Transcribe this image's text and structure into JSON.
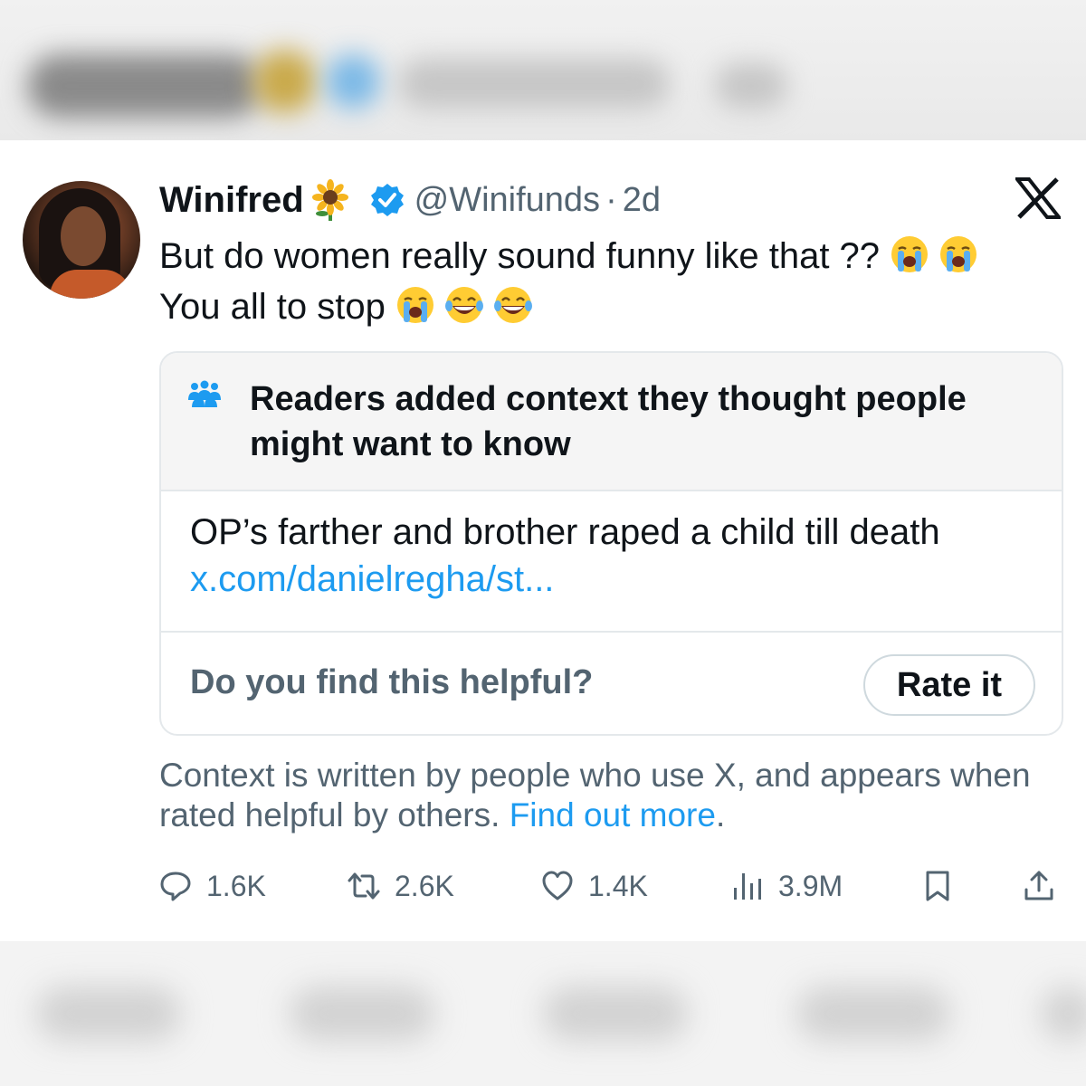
{
  "author": {
    "name": "Winifred",
    "handle": "@Winifunds",
    "separator": "·",
    "time": "2d",
    "verified": true
  },
  "tweet": {
    "line1": "But do women really sound funny like that ??",
    "line2": "You all to stop"
  },
  "note": {
    "title": "Readers added context they thought people might want to know",
    "body": "OP’s farther and brother raped a child till death",
    "link": "x.com/danielregha/st...",
    "question": "Do you find this helpful?",
    "rate_label": "Rate it"
  },
  "context": {
    "text": "Context is written by people who use X, and appears when rated helpful by others.",
    "link": "Find out more",
    "period": "."
  },
  "actions": {
    "replies": "1.6K",
    "reposts": "2.6K",
    "likes": "1.4K",
    "views": "3.9M"
  },
  "colors": {
    "primary_text": "#0f1419",
    "secondary_text": "#536471",
    "link": "#1d9bf0",
    "border": "#e4e8eb",
    "note_header_bg": "#f5f5f5"
  }
}
